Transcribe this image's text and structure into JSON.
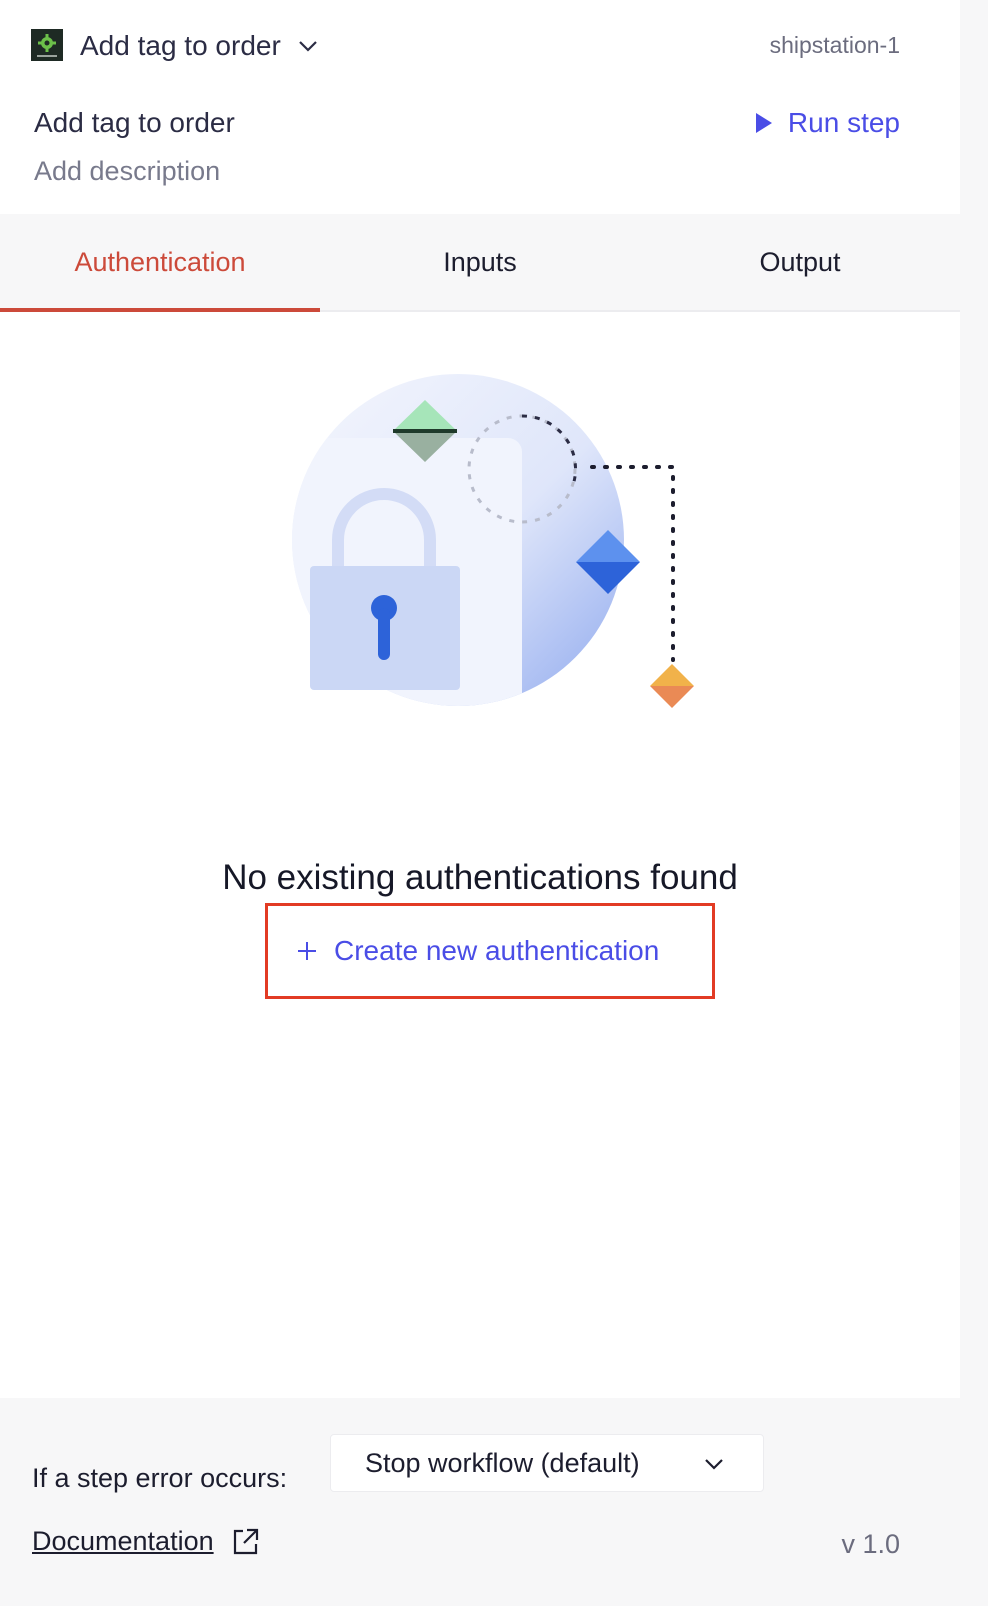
{
  "header": {
    "step_selector_label": "Add tag to order",
    "instance_name": "shipstation-1",
    "title": "Add tag to order",
    "description_placeholder": "Add description",
    "run_step_label": "Run step",
    "logo_icon": "shipstation-logo-icon"
  },
  "tabs": [
    {
      "label": "Authentication",
      "active": true
    },
    {
      "label": "Inputs",
      "active": false
    },
    {
      "label": "Output",
      "active": false
    }
  ],
  "empty_state": {
    "title": "No existing authentications found",
    "create_label": "Create new authentication",
    "illustration_icon": "lock-illustration"
  },
  "footer": {
    "error_label": "If a step error occurs:",
    "error_option": "Stop workflow (default)",
    "documentation_label": "Documentation",
    "version": "v 1.0"
  },
  "colors": {
    "accent": "#4a4de6",
    "active_tab": "#cc4a3a",
    "highlight_border": "#e23b24"
  }
}
